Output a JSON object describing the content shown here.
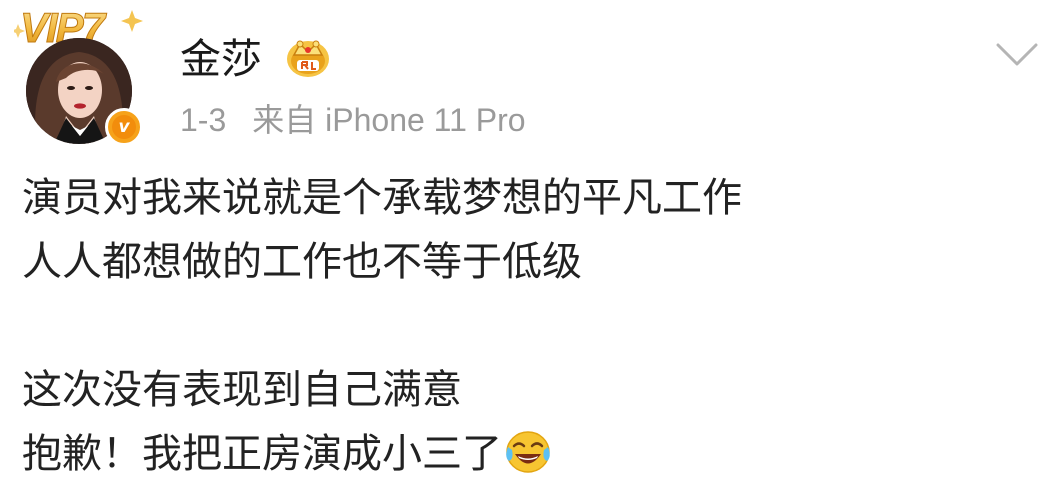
{
  "post": {
    "vip_label": "VIP7",
    "author": {
      "name": "金莎",
      "avatar": "avatar-woman-dark-hair",
      "verified_badge_glyph": "v",
      "verified_color": "#f28d0c",
      "crown_icon": "crown-icon"
    },
    "meta": {
      "time": "1-3",
      "source": "来自 iPhone 11 Pro"
    },
    "menu_icon": "chevron-down-icon",
    "lines": [
      "演员对我来说就是个承载梦想的平凡工作",
      "人人都想做的工作也不等于低级",
      "这次没有表现到自己满意",
      "抱歉！我把正房演成小三了"
    ],
    "trailing_emoji": "laugh-cry-emoji"
  }
}
